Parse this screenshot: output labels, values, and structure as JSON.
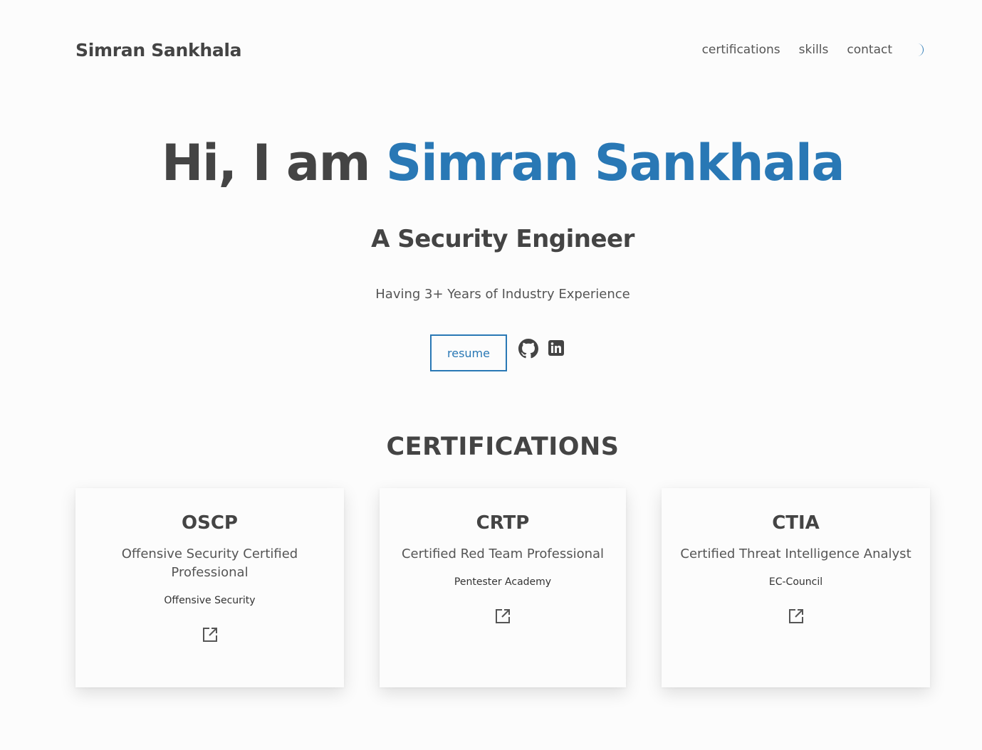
{
  "header": {
    "brand": "Simran Sankhala",
    "nav": [
      {
        "label": "certifications"
      },
      {
        "label": "skills"
      },
      {
        "label": "contact"
      }
    ],
    "theme_icon": "moon-icon",
    "accent_color": "#2978b5"
  },
  "hero": {
    "greeting": "Hi, I am",
    "name": "Simran Sankhala",
    "role": "A Security Engineer",
    "experience": "Having 3+ Years of Industry Experience",
    "resume_label": "resume",
    "social_icons": [
      "github-icon",
      "linkedin-icon"
    ]
  },
  "certifications": {
    "title": "CERTIFICATIONS",
    "items": [
      {
        "abbr": "OSCP",
        "name": "Offensive Security Certified Professional",
        "issuer": "Offensive Security",
        "link_icon": "external-link-icon"
      },
      {
        "abbr": "CRTP",
        "name": "Certified Red Team Professional",
        "issuer": "Pentester Academy",
        "link_icon": "external-link-icon"
      },
      {
        "abbr": "CTIA",
        "name": "Certified Threat Intelligence Analyst",
        "issuer": "EC-Council",
        "link_icon": "external-link-icon"
      }
    ]
  }
}
